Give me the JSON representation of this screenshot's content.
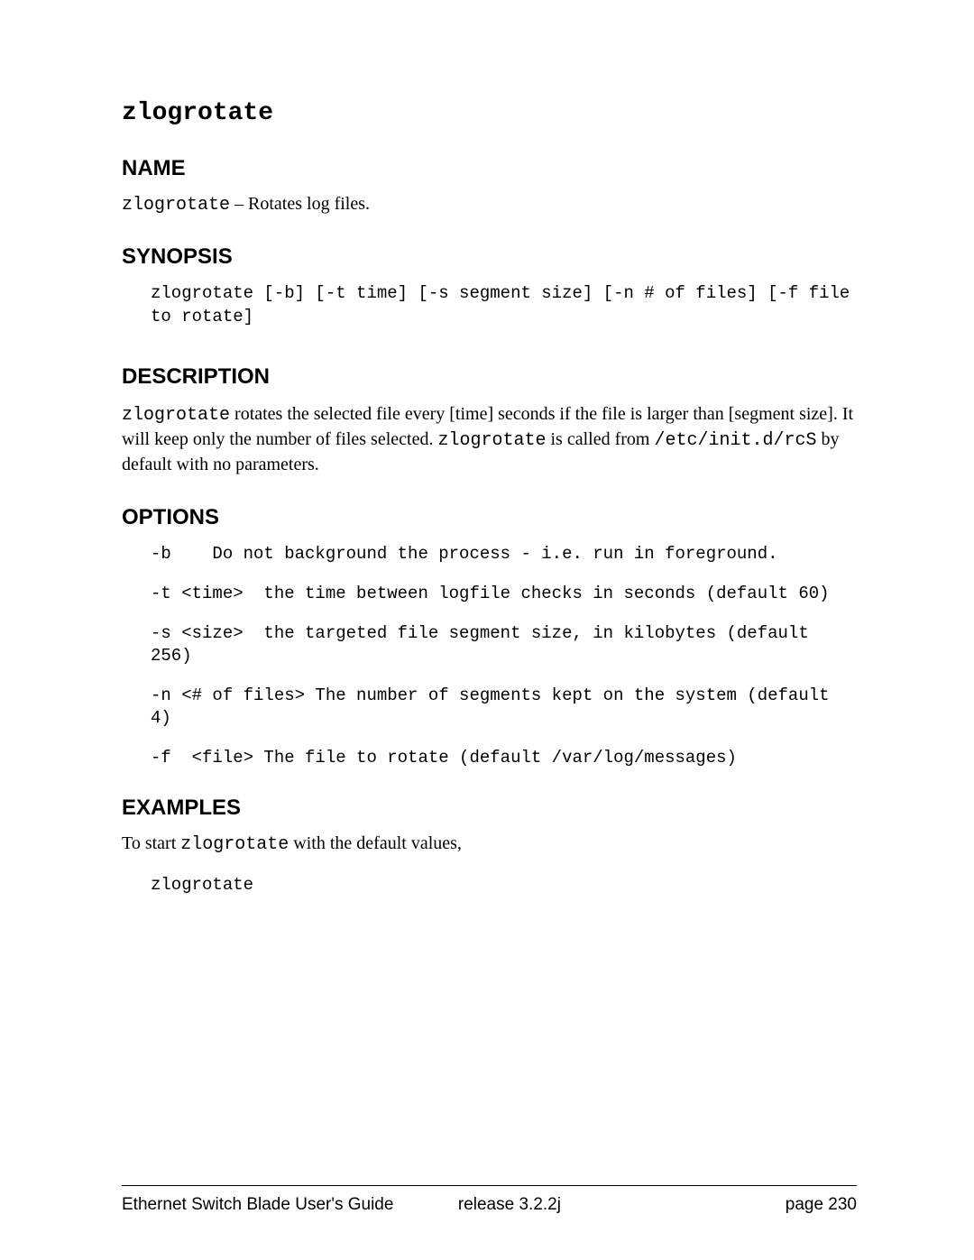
{
  "title": "zlogrotate",
  "sections": {
    "name": {
      "heading": "NAME",
      "command": "zlogrotate",
      "separator": " – ",
      "summary": "Rotates log files."
    },
    "synopsis": {
      "heading": "SYNOPSIS",
      "code": "zlogrotate [-b] [-t time] [-s segment size] [-n # of files] [-f file to rotate]"
    },
    "description": {
      "heading": "DESCRIPTION",
      "pre1": "zlogrotate",
      "mid1": " rotates the selected file every [time] seconds if the file is larger than [segment size]. It will keep only the number of files selected. ",
      "cmd2": "zlogrotate",
      "mid2": " is called from ",
      "path": "/etc/init.d/rcS",
      "post": " by default with no parameters."
    },
    "options": {
      "heading": "OPTIONS",
      "items": [
        "-b    Do not background the process - i.e. run in foreground.",
        "-t <time>  the time between logfile checks in seconds (default 60)",
        "-s <size>  the targeted file segment size, in kilobytes (default 256)",
        "-n <# of files> The number of segments kept on the system (default 4)",
        "-f  <file> The file to rotate (default /var/log/messages)"
      ]
    },
    "examples": {
      "heading": "EXAMPLES",
      "intro_pre": "To start ",
      "intro_cmd": "zlogrotate",
      "intro_post": " with the default values,",
      "code": "zlogrotate"
    }
  },
  "footer": {
    "doc_title": "Ethernet Switch Blade User's Guide",
    "release_label": "release  3.2.2j",
    "page_label": "page  230"
  }
}
